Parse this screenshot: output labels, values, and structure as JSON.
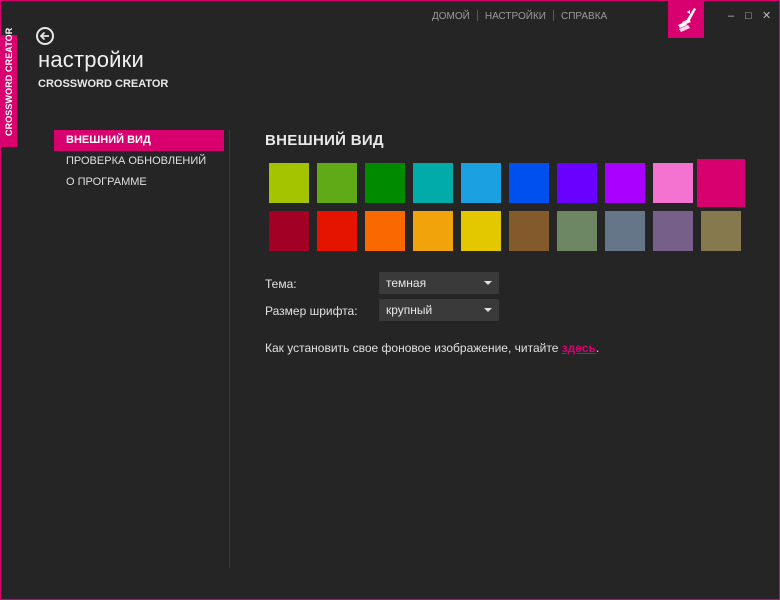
{
  "app": {
    "side_tab": "CROSSWORD CREATOR",
    "page_title": "настройки",
    "app_name": "CROSSWORD CREATOR",
    "accent_color": "#d8006f"
  },
  "topnav": [
    "ДОМОЙ",
    "НАСТРОЙКИ",
    "СПРАВКА"
  ],
  "window_controls": {
    "minimize": "–",
    "maximize": "□",
    "close": "✕"
  },
  "sidebar": {
    "items": [
      {
        "label": "ВНЕШНИЙ ВИД",
        "active": true
      },
      {
        "label": "ПРОВЕРКА ОБНОВЛЕНИЙ",
        "active": false
      },
      {
        "label": "О ПРОГРАММЕ",
        "active": false
      }
    ]
  },
  "appearance": {
    "title": "ВНЕШНИЙ ВИД",
    "colors_row1": [
      "#a4c400",
      "#60a917",
      "#008a00",
      "#00aba9",
      "#1ba1e2",
      "#0050ef",
      "#6a00ff",
      "#aa00ff",
      "#f472d0",
      "#d8006f"
    ],
    "colors_row2": [
      "#a20025",
      "#e51400",
      "#fa6800",
      "#f0a30a",
      "#e3c800",
      "#825a2c",
      "#6d8764",
      "#647687",
      "#76608a",
      "#87794e"
    ],
    "selected_color": "#d8006f",
    "theme_label": "Тема:",
    "theme_value": "темная",
    "font_label": "Размер шрифта:",
    "font_value": "крупный",
    "info_text": "Как установить свое фоновое изображение, читайте ",
    "info_link": "здесь",
    "info_end": "."
  }
}
